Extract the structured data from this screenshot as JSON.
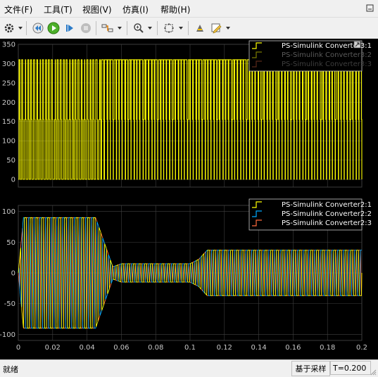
{
  "menu": [
    "文件(F)",
    "工具(T)",
    "视图(V)",
    "仿真(I)",
    "帮助(H)"
  ],
  "toolbar": {
    "icons": [
      "gear-icon",
      "rewind-icon",
      "play-icon",
      "step-forward-icon",
      "stop-icon",
      "signal-select-icon",
      "zoom-in-icon",
      "fit-view-icon",
      "highlight-icon",
      "style-edit-icon"
    ]
  },
  "colors": {
    "trace1": "#ffff00",
    "trace2": "#00aaff",
    "trace3": "#ff6a3d",
    "axes_bg": "#000000",
    "grid": "#404040",
    "tick_text": "#c8c8c8"
  },
  "chart_data": [
    {
      "type": "line",
      "xlim": [
        0,
        0.2
      ],
      "ylim": [
        -20,
        350
      ],
      "yticks": [
        "350",
        "300",
        "250",
        "200",
        "150",
        "100",
        "50",
        "0"
      ],
      "grid": true,
      "legend_position": "top-right",
      "series": [
        {
          "name": "PS-Simulink Converter3:1",
          "pattern": "pwm",
          "levels": [
            0,
            155,
            310
          ],
          "x": [
            0,
            0.043,
            0.047,
            0.05,
            0.2
          ],
          "duty": [
            0.35,
            0.35,
            0.55,
            0.78,
            0.78
          ]
        },
        {
          "name": "PS-Simulink Converter3:2",
          "pattern": "hidden"
        },
        {
          "name": "PS-Simulink Converter3:3",
          "pattern": "hidden"
        }
      ]
    },
    {
      "type": "line",
      "xlim": [
        0,
        0.2
      ],
      "ylim": [
        -110,
        110
      ],
      "xticks": [
        "0",
        "0.02",
        "0.04",
        "0.06",
        "0.08",
        "0.1",
        "0.12",
        "0.14",
        "0.16",
        "0.18",
        "0.2"
      ],
      "yticks": [
        "100",
        "50",
        "0",
        "-50",
        "-100"
      ],
      "grid": true,
      "legend_position": "top-right",
      "series": [
        {
          "name": "PS-Simulink Converter2:1",
          "phase": 0
        },
        {
          "name": "PS-Simulink Converter2:2",
          "phase": 2.094
        },
        {
          "name": "PS-Simulink Converter2:3",
          "phase": 4.189
        }
      ],
      "envelope": {
        "x": [
          0,
          0.003,
          0.045,
          0.05,
          0.055,
          0.06,
          0.1,
          0.105,
          0.11,
          0.2
        ],
        "amplitude": [
          0,
          90,
          90,
          50,
          10,
          15,
          15,
          22,
          37,
          37
        ]
      },
      "frequency_hz": 300
    }
  ],
  "status": {
    "left": "就绪",
    "mode": "基于采样",
    "time": "T=0.200"
  }
}
